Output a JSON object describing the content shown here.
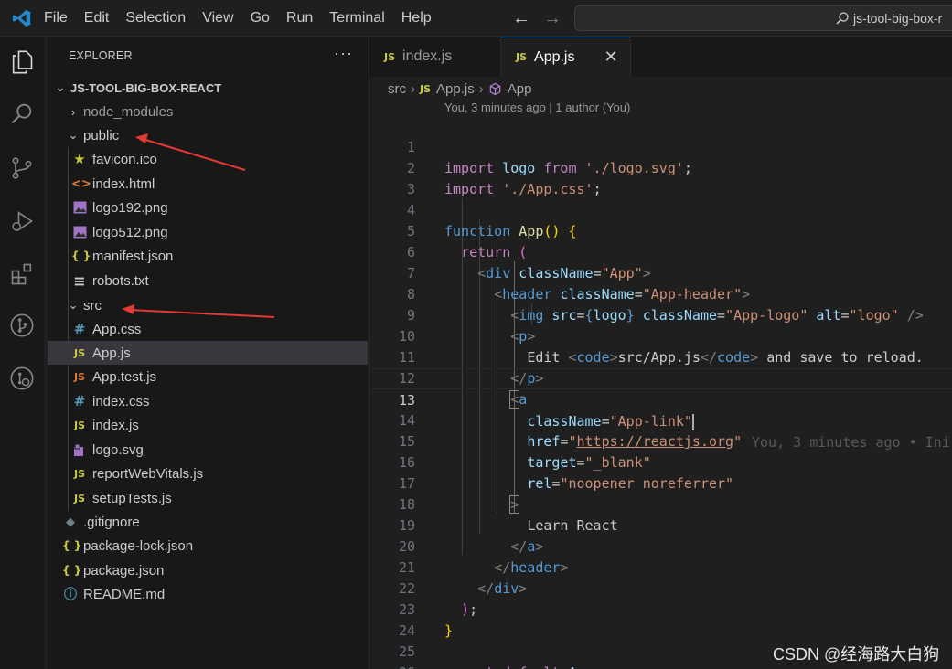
{
  "menu": [
    "File",
    "Edit",
    "Selection",
    "View",
    "Go",
    "Run",
    "Terminal",
    "Help"
  ],
  "search": {
    "text": "js-tool-big-box-r"
  },
  "explorer": {
    "title": "EXPLORER",
    "more": "···",
    "root": "JS-TOOL-BIG-BOX-REACT",
    "items": [
      {
        "label": "node_modules",
        "icon": "chevron-right-icon"
      },
      {
        "label": "public",
        "icon": "chevron-down-icon"
      },
      {
        "label": "favicon.ico",
        "icon": "star-icon"
      },
      {
        "label": "index.html",
        "icon": "html-icon"
      },
      {
        "label": "logo192.png",
        "icon": "image-icon"
      },
      {
        "label": "logo512.png",
        "icon": "image-icon"
      },
      {
        "label": "manifest.json",
        "icon": "json-icon"
      },
      {
        "label": "robots.txt",
        "icon": "text-file-icon"
      },
      {
        "label": "src",
        "icon": "chevron-down-icon"
      },
      {
        "label": "App.css",
        "icon": "css-icon"
      },
      {
        "label": "App.js",
        "icon": "js-icon"
      },
      {
        "label": "App.test.js",
        "icon": "js-test-icon"
      },
      {
        "label": "index.css",
        "icon": "css-icon"
      },
      {
        "label": "index.js",
        "icon": "js-icon"
      },
      {
        "label": "logo.svg",
        "icon": "svg-icon"
      },
      {
        "label": "reportWebVitals.js",
        "icon": "js-icon"
      },
      {
        "label": "setupTests.js",
        "icon": "js-icon"
      },
      {
        "label": ".gitignore",
        "icon": "git-icon"
      },
      {
        "label": "package-lock.json",
        "icon": "json-icon"
      },
      {
        "label": "package.json",
        "icon": "json-icon"
      },
      {
        "label": "README.md",
        "icon": "info-icon"
      }
    ],
    "icon_glyphs": {
      "js": "JS",
      "css": "#",
      "json": "{ }",
      "html": "<>",
      "star": "★",
      "info": "ⓘ",
      "git": "◆",
      "txt": "≡"
    }
  },
  "tabs": [
    {
      "label": "index.js",
      "active": false
    },
    {
      "label": "App.js",
      "active": true,
      "close": "✕"
    }
  ],
  "breadcrumb": {
    "folder": "src",
    "sep": "›",
    "file": "App.js",
    "symbol": "App"
  },
  "codelens": "You, 3 minutes ago | 1 author (You)",
  "code": {
    "line_numbers": [
      "1",
      "2",
      "3",
      "4",
      "5",
      "6",
      "7",
      "8",
      "9",
      "10",
      "11",
      "12",
      "13",
      "14",
      "15",
      "16",
      "17",
      "18",
      "19",
      "20",
      "21",
      "22",
      "23",
      "24",
      "25",
      "26"
    ],
    "current_line": 13,
    "ghost_text": "You, 3 minutes ago • Ini"
  },
  "watermark": "CSDN @经海路大白狗",
  "colors": {
    "accent": "#0078d4",
    "annotation": "#e53935"
  }
}
